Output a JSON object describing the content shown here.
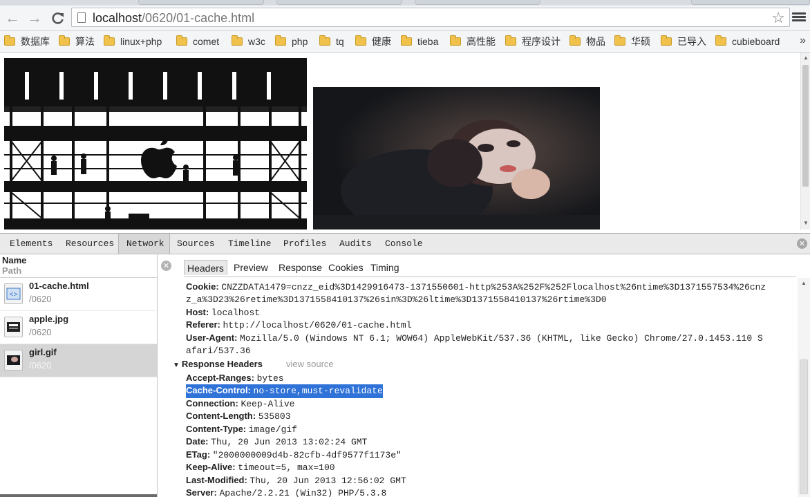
{
  "browser": {
    "url_host": "localhost",
    "url_path": "/0620/01-cache.html",
    "bookmarks": [
      "数据库",
      "算法",
      "linux+php",
      "comet",
      "w3c",
      "php",
      "tq",
      "健康",
      "tieba",
      "高性能",
      "程序设计",
      "物品",
      "华硕",
      "已导入",
      "cubieboard"
    ],
    "more": "»"
  },
  "devtools": {
    "tabs": [
      "Elements",
      "Resources",
      "Network",
      "Sources",
      "Timeline",
      "Profiles",
      "Audits",
      "Console"
    ],
    "active_tab": "Network",
    "list_header": {
      "name": "Name",
      "path": "Path"
    },
    "requests": [
      {
        "name": "01-cache.html",
        "path": "/0620",
        "icon": "html-file-icon"
      },
      {
        "name": "apple.jpg",
        "path": "/0620",
        "icon": "image-file-icon"
      },
      {
        "name": "girl.gif",
        "path": "/0620",
        "icon": "image-file-icon",
        "selected": true
      }
    ],
    "detail_tabs": [
      "Headers",
      "Preview",
      "Response",
      "Cookies",
      "Timing"
    ],
    "active_detail_tab": "Headers",
    "request_headers": [
      {
        "key": "Cookie:",
        "value": "CNZZDATA1479=cnzz_eid%3D1429916473-1371550601-http%253A%252F%252Flocalhost%26ntime%3D1371557534%26cnz"
      },
      {
        "key": "",
        "value": "z_a%3D23%26retime%3D1371558410137%26sin%3D%26ltime%3D1371558410137%26rtime%3D0"
      },
      {
        "key": "Host:",
        "value": "localhost"
      },
      {
        "key": "Referer:",
        "value": "http://localhost/0620/01-cache.html"
      },
      {
        "key": "User-Agent:",
        "value": "Mozilla/5.0 (Windows NT 6.1; WOW64) AppleWebKit/537.36 (KHTML, like Gecko) Chrome/27.0.1453.110 S"
      },
      {
        "key": "",
        "value": "afari/537.36"
      }
    ],
    "response_section": {
      "title": "Response Headers",
      "view_source": "view source"
    },
    "response_headers": [
      {
        "key": "Accept-Ranges:",
        "value": "bytes"
      },
      {
        "key": "Cache-Control:",
        "value": "no-store,must-revalidate",
        "highlight": true
      },
      {
        "key": "Connection:",
        "value": "Keep-Alive"
      },
      {
        "key": "Content-Length:",
        "value": "535803"
      },
      {
        "key": "Content-Type:",
        "value": "image/gif"
      },
      {
        "key": "Date:",
        "value": "Thu, 20 Jun 2013 13:02:24 GMT"
      },
      {
        "key": "ETag:",
        "value": "\"2000000009d4b-82cfb-4df9577f1173e\""
      },
      {
        "key": "Keep-Alive:",
        "value": "timeout=5, max=100"
      },
      {
        "key": "Last-Modified:",
        "value": "Thu, 20 Jun 2013 12:56:02 GMT"
      },
      {
        "key": "Server:",
        "value": "Apache/2.2.21 (Win32) PHP/5.3.8"
      }
    ],
    "highlight_color": "#2f72d8"
  }
}
